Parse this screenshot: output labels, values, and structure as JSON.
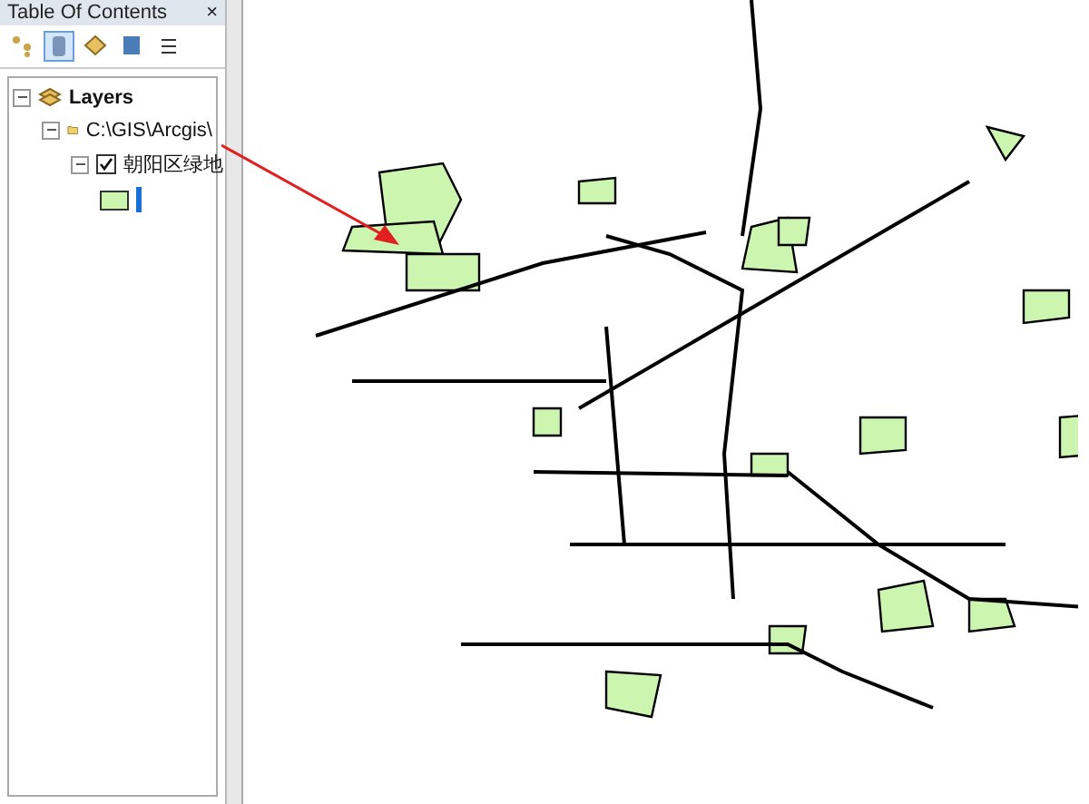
{
  "toc": {
    "title": "Table Of Contents",
    "close": "×",
    "tree": {
      "label": "Layers",
      "expanded": true,
      "children": [
        {
          "label": "C:\\GIS\\Arcgis\\",
          "expanded": true,
          "children": [
            {
              "label": "朝阳区绿地",
              "checked": true,
              "expanded": true,
              "color": "#ccf5b0"
            }
          ]
        }
      ]
    }
  }
}
